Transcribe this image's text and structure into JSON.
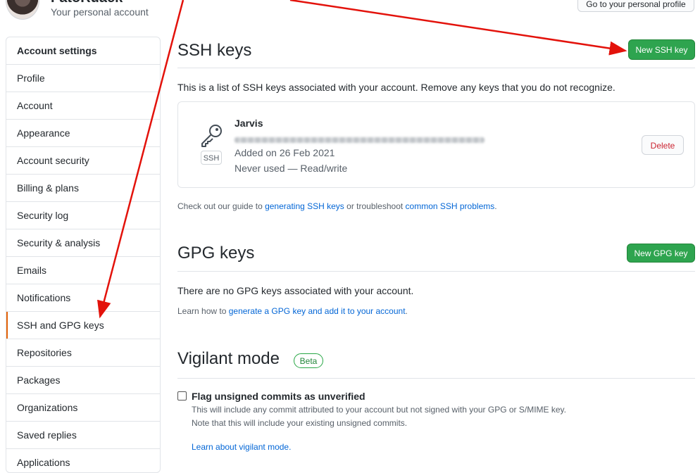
{
  "header": {
    "username": "FatoRuack",
    "subtitle": "Your personal account",
    "profile_button": "Go to your personal profile"
  },
  "sidebar": {
    "title": "Account settings",
    "items": [
      {
        "label": "Profile"
      },
      {
        "label": "Account"
      },
      {
        "label": "Appearance"
      },
      {
        "label": "Account security"
      },
      {
        "label": "Billing & plans"
      },
      {
        "label": "Security log"
      },
      {
        "label": "Security & analysis"
      },
      {
        "label": "Emails"
      },
      {
        "label": "Notifications"
      },
      {
        "label": "SSH and GPG keys",
        "selected": true
      },
      {
        "label": "Repositories"
      },
      {
        "label": "Packages"
      },
      {
        "label": "Organizations"
      },
      {
        "label": "Saved replies"
      },
      {
        "label": "Applications"
      }
    ]
  },
  "ssh": {
    "title": "SSH keys",
    "new_button": "New SSH key",
    "description": "This is a list of SSH keys associated with your account. Remove any keys that you do not recognize.",
    "key": {
      "name": "Jarvis",
      "badge": "SSH",
      "added": "Added on 26 Feb 2021",
      "usage": "Never used — Read/write",
      "delete_label": "Delete"
    },
    "guide": {
      "prefix": "Check out our guide to ",
      "link1": "generating SSH keys",
      "middle": " or troubleshoot ",
      "link2": "common SSH problems",
      "suffix": "."
    }
  },
  "gpg": {
    "title": "GPG keys",
    "new_button": "New GPG key",
    "empty": "There are no GPG keys associated with your account.",
    "learn_prefix": "Learn how to ",
    "learn_link": "generate a GPG key and add it to your account",
    "learn_suffix": "."
  },
  "vigilant": {
    "title": "Vigilant mode",
    "badge": "Beta",
    "checkbox_label": "Flag unsigned commits as unverified",
    "line1": "This will include any commit attributed to your account but not signed with your GPG or S/MIME key.",
    "line2": "Note that this will include your existing unsigned commits.",
    "learn_link": "Learn about vigilant mode."
  },
  "colors": {
    "primary_green": "#2ea44f",
    "link_blue": "#0366d6",
    "annotation_red": "#e3120b",
    "selected_accent": "#e36209"
  }
}
